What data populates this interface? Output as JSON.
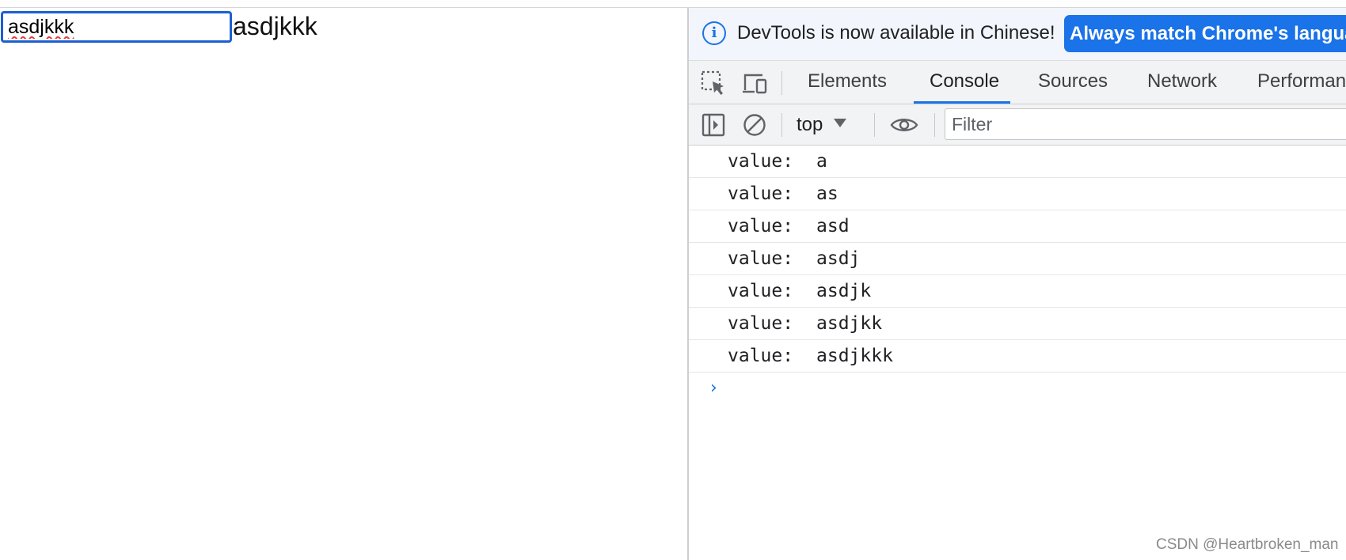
{
  "page": {
    "input_value": "asdjkkk",
    "echo_text": "asdjkkk"
  },
  "devtools": {
    "infobar": {
      "message": "DevTools is now available in Chinese!",
      "button_label": "Always match Chrome's language"
    },
    "toolbar_icons": [
      "inspect-element-icon",
      "device-toggle-icon"
    ],
    "tabs": [
      {
        "label": "Elements",
        "active": false
      },
      {
        "label": "Console",
        "active": true
      },
      {
        "label": "Sources",
        "active": false
      },
      {
        "label": "Network",
        "active": false
      },
      {
        "label": "Performance",
        "active": false
      }
    ],
    "console_toolbar": {
      "context": "top",
      "filter_placeholder": "Filter"
    },
    "console_logs": [
      {
        "key": "value:",
        "value": "a"
      },
      {
        "key": "value:",
        "value": "as"
      },
      {
        "key": "value:",
        "value": "asd"
      },
      {
        "key": "value:",
        "value": "asdj"
      },
      {
        "key": "value:",
        "value": "asdjk"
      },
      {
        "key": "value:",
        "value": "asdjkk"
      },
      {
        "key": "value:",
        "value": "asdjkkk"
      }
    ],
    "prompt_symbol": "›"
  },
  "watermark": "CSDN @Heartbroken_man",
  "colors": {
    "accent": "#1a73e8",
    "input_border": "#1d5fd1",
    "toolbar_bg": "#f1f3f4",
    "infobar_bg": "#f2f5fb"
  }
}
